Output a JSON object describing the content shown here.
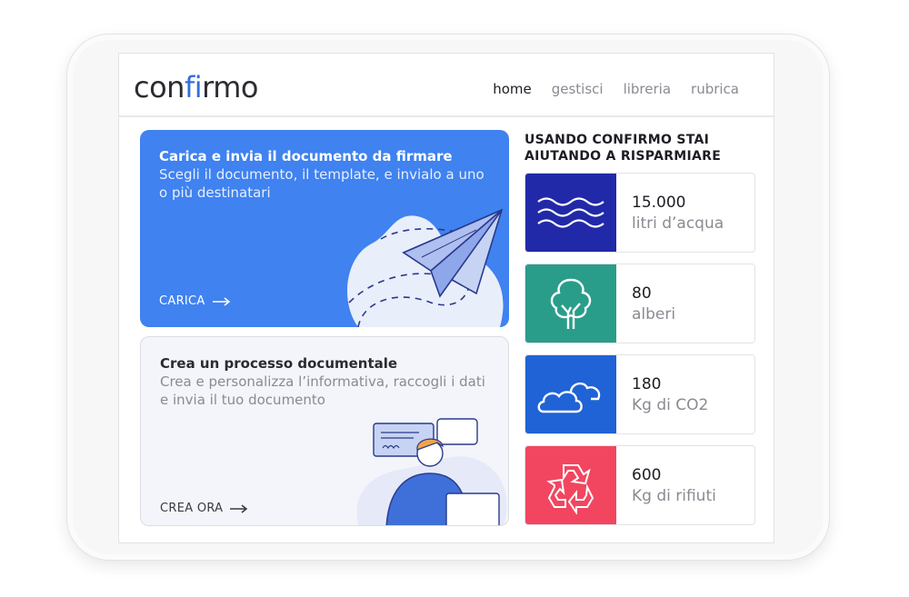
{
  "brand": {
    "logo_prefix": "con",
    "logo_accent": "fi",
    "logo_suffix": "rmo",
    "accent_color": "#2f6fe0"
  },
  "nav": {
    "items": [
      {
        "label": "home",
        "active": true
      },
      {
        "label": "gestisci",
        "active": false
      },
      {
        "label": "libreria",
        "active": false
      },
      {
        "label": "rubrica",
        "active": false
      }
    ]
  },
  "cards": {
    "upload": {
      "title": "Carica e invia il documento da firmare",
      "description": "Scegli il documento, il template, e invialo a uno o più destinatari",
      "cta": "CARICA",
      "color": "#3f82f0",
      "icon": "paper-plane-icon"
    },
    "process": {
      "title": "Crea un processo documentale",
      "description": "Crea e personalizza l’informativa, raccogli i dati e invia il tuo documento",
      "cta": "CREA ORA",
      "icon": "person-laptop-icon"
    }
  },
  "savings": {
    "title": "USANDO CONFIRMO STAI AIUTANDO A RISPARMIARE",
    "items": [
      {
        "value": "15.000",
        "label": "litri d’acqua",
        "color": "#2229a8",
        "icon": "water-waves-icon"
      },
      {
        "value": "80",
        "label": "alberi",
        "color": "#2a9d8a",
        "icon": "tree-icon"
      },
      {
        "value": "180",
        "label": "Kg di CO2",
        "color": "#1f63d6",
        "icon": "clouds-icon"
      },
      {
        "value": "600",
        "label": "Kg di rifiuti",
        "color": "#f24660",
        "icon": "recycle-icon"
      }
    ]
  }
}
